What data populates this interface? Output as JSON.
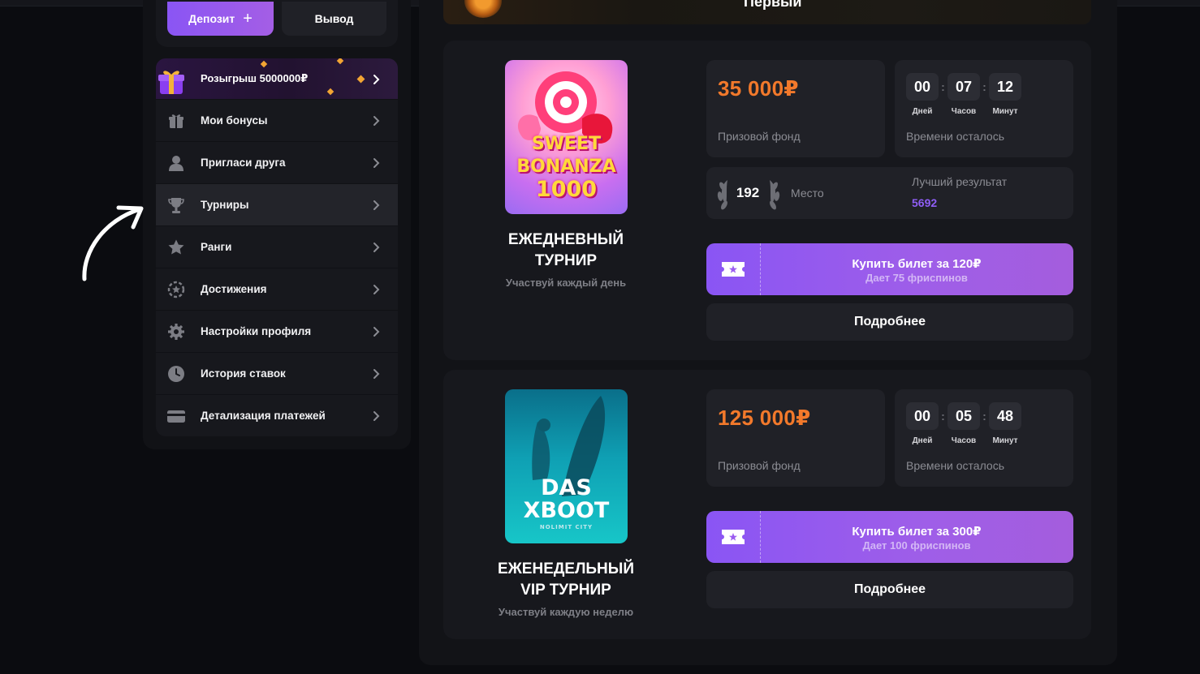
{
  "account": {
    "deposit_label": "Депозит",
    "withdraw_label": "Вывод"
  },
  "menu": {
    "giveaway_label": "Розыгрыш 5000000₽",
    "items": [
      {
        "label": "Мои бонусы",
        "icon": "gift-icon"
      },
      {
        "label": "Пригласи друга",
        "icon": "user-icon"
      },
      {
        "label": "Турниры",
        "icon": "trophy-icon"
      },
      {
        "label": "Ранги",
        "icon": "star-icon"
      },
      {
        "label": "Достижения",
        "icon": "achievement-icon"
      },
      {
        "label": "Настройки профиля",
        "icon": "gear-icon"
      },
      {
        "label": "История ставок",
        "icon": "clock-icon"
      },
      {
        "label": "Детализация платежей",
        "icon": "card-icon"
      }
    ],
    "active_item": "Турниры"
  },
  "banner": {
    "title_partial": "Первый"
  },
  "tournaments": [
    {
      "game_logo_lines": [
        "SWEET",
        "BONANZA",
        "1000"
      ],
      "name_line1": "ЕЖЕДНЕВНЫЙ",
      "name_line2": "ТУРНИР",
      "subtitle": "Участвуй каждый день",
      "prize": "35 000₽",
      "prize_label": "Призовой фонд",
      "timer": {
        "days": "00",
        "hours": "07",
        "minutes": "12"
      },
      "timer_labels": {
        "days": "Дней",
        "hours": "Часов",
        "minutes": "Минут"
      },
      "time_left_label": "Времени осталось",
      "place": "192",
      "place_label": "Место",
      "best_result_label": "Лучший результат",
      "best_result": "5692",
      "buy_label": "Купить билет за 120₽",
      "buy_sub": "Дает 75 фриспинов",
      "more_label": "Подробнее"
    },
    {
      "game_logo_lines": [
        "DAS",
        "XBOOT",
        "NOLIMIT CITY"
      ],
      "name_line1": "ЕЖЕНЕДЕЛЬНЫЙ",
      "name_line2": "VIP ТУРНИР",
      "subtitle": "Участвуй каждую неделю",
      "prize": "125 000₽",
      "prize_label": "Призовой фонд",
      "timer": {
        "days": "00",
        "hours": "05",
        "minutes": "48"
      },
      "timer_labels": {
        "days": "Дней",
        "hours": "Часов",
        "minutes": "Минут"
      },
      "time_left_label": "Времени осталось",
      "buy_label": "Купить билет за 300₽",
      "buy_sub": "Дает 100 фриспинов",
      "more_label": "Подробнее"
    }
  ],
  "colors": {
    "accent_purple": "#8a55f4",
    "prize_orange": "#f2792b",
    "best_result_purple": "#8f5ef5"
  }
}
